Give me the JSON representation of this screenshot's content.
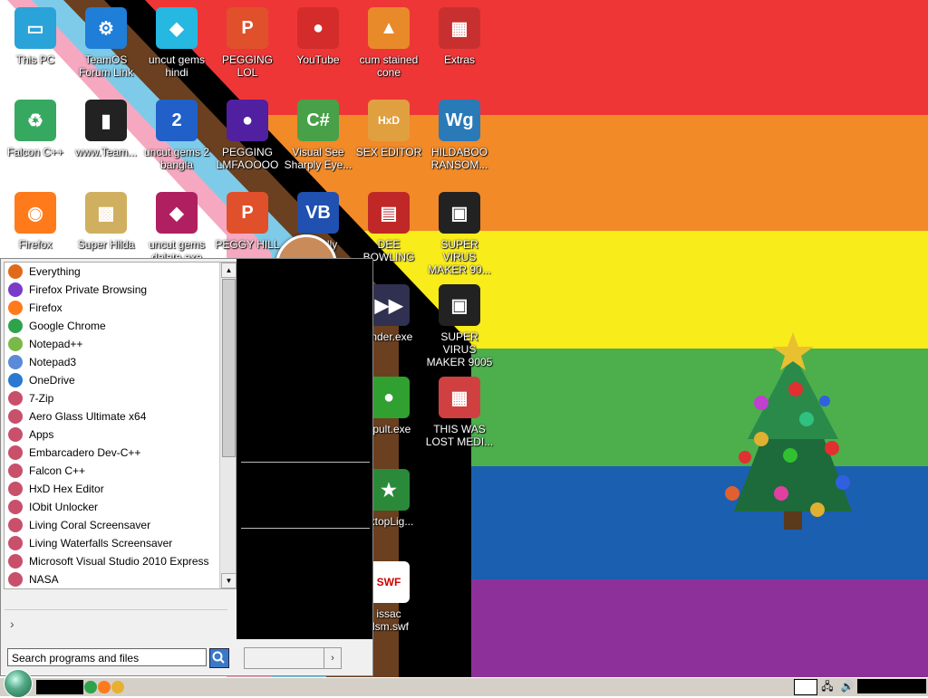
{
  "colors": {
    "flag_stripes": [
      "#ef3636",
      "#f28a28",
      "#f8ec1a",
      "#4caf4c",
      "#1b5fb0",
      "#8e3099"
    ],
    "progress_black": "#000000",
    "light_blue": "#7ecbe9",
    "pink": "#f5a8c0",
    "brown": "#6a4020"
  },
  "desktop": {
    "icons": [
      {
        "label": "This PC",
        "icon": "monitor-icon",
        "color": "#2aa3d8",
        "glyph": "▭"
      },
      {
        "label": "TeamOS\nForum Link",
        "icon": "gear-icon",
        "color": "#1e7ed8",
        "glyph": "⚙"
      },
      {
        "label": "uncut gems\nhindi",
        "icon": "diamond-icon",
        "color": "#26b8e0",
        "glyph": "◆"
      },
      {
        "label": "PEGGING LOL",
        "icon": "p-ball-icon",
        "color": "#e0502a",
        "glyph": "P"
      },
      {
        "label": "YouTube",
        "icon": "angry-bird-icon",
        "color": "#d42b2b",
        "glyph": "●"
      },
      {
        "label": "cum stained\ncone",
        "icon": "traffic-cone-icon",
        "color": "#e88a2a",
        "glyph": "▲"
      },
      {
        "label": "Extras",
        "icon": "gift-icon",
        "color": "#c83030",
        "glyph": "▦"
      },
      {
        "label": "Falcon C++",
        "icon": "recycle-bin-icon",
        "color": "#37a860",
        "glyph": "♻"
      },
      {
        "label": "www.Team...",
        "icon": "tower-pc-icon",
        "color": "#222222",
        "glyph": "▮"
      },
      {
        "label": "uncut gems 2\nbangla",
        "icon": "two-icon",
        "color": "#2060c8",
        "glyph": "2"
      },
      {
        "label": "PEGGING\nLMFAOOOO",
        "icon": "bomb-icon",
        "color": "#5020a0",
        "glyph": "●"
      },
      {
        "label": "Visual See\nSharply Eye...",
        "icon": "csharp-icon",
        "color": "#48a048",
        "glyph": "C#"
      },
      {
        "label": "SEX EDITOR",
        "icon": "hxd-icon",
        "color": "#e0a040",
        "glyph": "HxD"
      },
      {
        "label": "HILDABOO\nRANSOM...",
        "icon": "wg-icon",
        "color": "#2a7ab8",
        "glyph": "Wg"
      },
      {
        "label": "Firefox",
        "icon": "firefox-icon",
        "color": "#ff7a1a",
        "glyph": "◉"
      },
      {
        "label": "Super Hilda",
        "icon": "pixel-character-icon",
        "color": "#d0b060",
        "glyph": "▩"
      },
      {
        "label": "uncut gems\ndelete.exe",
        "icon": "gem-disc-icon",
        "color": "#b02060",
        "glyph": "◆"
      },
      {
        "label": "PEGGY HILL",
        "icon": "p-ball-icon",
        "color": "#e0502a",
        "glyph": "P"
      },
      {
        "label": "Virtually\nBasic...",
        "icon": "vb-icon",
        "color": "#2050b0",
        "glyph": "VB"
      },
      {
        "label": "DEE BOWLING",
        "icon": "book-icon",
        "color": "#c02828",
        "glyph": "▤"
      },
      {
        "label": "SUPER VIRUS\nMAKER 90...",
        "icon": "camera-bag-icon",
        "color": "#222222",
        "glyph": "▣"
      },
      {
        "label": "ender.exe",
        "icon": "robot-icon",
        "color": "#303050",
        "glyph": "▶▶"
      },
      {
        "label": "SUPER VIRUS\nMAKER 9005",
        "icon": "camera-bag-icon",
        "color": "#222222",
        "glyph": "▣"
      },
      {
        "label": "gpult.exe",
        "icon": "frog-icon",
        "color": "#30a030",
        "glyph": "●"
      },
      {
        "label": "THIS WAS\nLOST MEDI...",
        "icon": "colored-box-icon",
        "color": "#d04040",
        "glyph": "▦"
      },
      {
        "label": "sktopLig...",
        "icon": "star-tree-icon",
        "color": "#2a8a3a",
        "glyph": "★"
      },
      {
        "label": "issac\ndsm.swf",
        "icon": "swf-file-icon",
        "color": "#ffffff",
        "glyph": "SWF"
      }
    ]
  },
  "start_menu": {
    "programs": [
      {
        "label": "Everything",
        "icon": "magnifier-icon",
        "color": "#e06a1a"
      },
      {
        "label": "Firefox Private Browsing",
        "icon": "firefox-private-icon",
        "color": "#7a3cc8"
      },
      {
        "label": "Firefox",
        "icon": "firefox-icon",
        "color": "#ff7a1a"
      },
      {
        "label": "Google Chrome",
        "icon": "chrome-icon",
        "color": "#2fa34b"
      },
      {
        "label": "Notepad++",
        "icon": "notepad-plus-icon",
        "color": "#7ab84a"
      },
      {
        "label": "Notepad3",
        "icon": "notepad3-icon",
        "color": "#5a8ad8"
      },
      {
        "label": "OneDrive",
        "icon": "cloud-icon",
        "color": "#2a78d0"
      },
      {
        "label": "7-Zip",
        "icon": "folder-shortcut-icon",
        "color": "#c8506a"
      },
      {
        "label": "Aero Glass Ultimate x64",
        "icon": "folder-shortcut-icon",
        "color": "#c8506a"
      },
      {
        "label": "Apps",
        "icon": "folder-shortcut-icon",
        "color": "#c8506a"
      },
      {
        "label": "Embarcadero Dev-C++",
        "icon": "folder-shortcut-icon",
        "color": "#c8506a"
      },
      {
        "label": "Falcon C++",
        "icon": "folder-shortcut-icon",
        "color": "#c8506a"
      },
      {
        "label": "HxD Hex Editor",
        "icon": "folder-shortcut-icon",
        "color": "#c8506a"
      },
      {
        "label": "IObit Unlocker",
        "icon": "folder-shortcut-icon",
        "color": "#c8506a"
      },
      {
        "label": "Living Coral Screensaver",
        "icon": "folder-shortcut-icon",
        "color": "#c8506a"
      },
      {
        "label": "Living Waterfalls Screensaver",
        "icon": "folder-shortcut-icon",
        "color": "#c8506a"
      },
      {
        "label": "Microsoft Visual Studio 2010 Express",
        "icon": "folder-shortcut-icon",
        "color": "#c8506a"
      },
      {
        "label": "NASA",
        "icon": "folder-shortcut-icon",
        "color": "#c8506a"
      }
    ],
    "all_programs_glyph": "›",
    "search_placeholder": "Search programs and files",
    "shutdown_arrow": "›"
  },
  "taskbar": {
    "start_icon": "start-orb-icon",
    "quick_launch": [
      {
        "icon": "chrome-icon",
        "color": "#2fa34b"
      },
      {
        "icon": "firefox-icon",
        "color": "#ff7a1a"
      },
      {
        "icon": "folder-icon",
        "color": "#e8b030"
      }
    ],
    "tray": {
      "network_glyph": "🖧",
      "volume_glyph": "🔊"
    }
  }
}
